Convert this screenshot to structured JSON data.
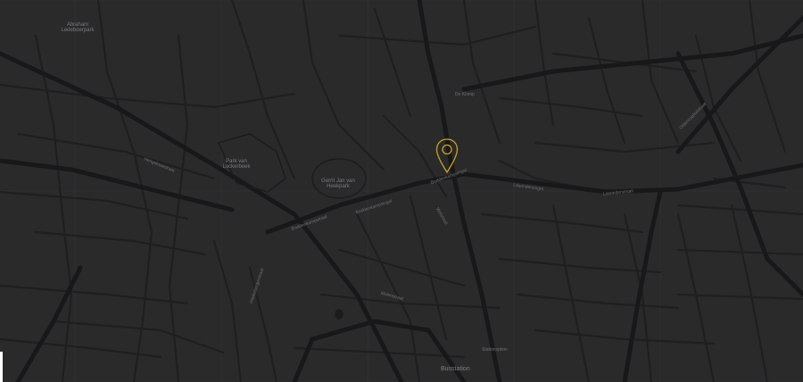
{
  "map": {
    "background": "#2a2a2b",
    "road_color": "#1e1e1f",
    "major_road_color": "#19191a",
    "grid_color": "#3a3a3c",
    "label_color": "#6f6f72"
  },
  "marker": {
    "icon": "map-pin-icon",
    "color": "#c9a227"
  },
  "labels": {
    "abraham_park": "Abraham Ledeboerpark",
    "park_lockerbeek": "Park van Lockerbeek",
    "gerrit_park": "Gerrit Jan van Heekpark",
    "boddenkampsingel_1": "Boddenkampsingel",
    "boddenkampsingel_2": "Boddenkampsingel",
    "boddenkampstraat": "Boddenkampstraat",
    "lasondersingel_1": "Lasondersingel",
    "lasondersingel_2": "Lasondersingel",
    "hengelosestraat": "Hengelosestraat",
    "bosstation": "Busstation",
    "molenstraat": "Molenstraat",
    "haaksbergerstraat": "Haaksbergerstraat",
    "oldenzaalsestraat": "Oldenzaalsestraat",
    "de_klomp": "De Klomp",
    "walstraat": "Walstraat",
    "stationsplein": "Stationsplein"
  }
}
